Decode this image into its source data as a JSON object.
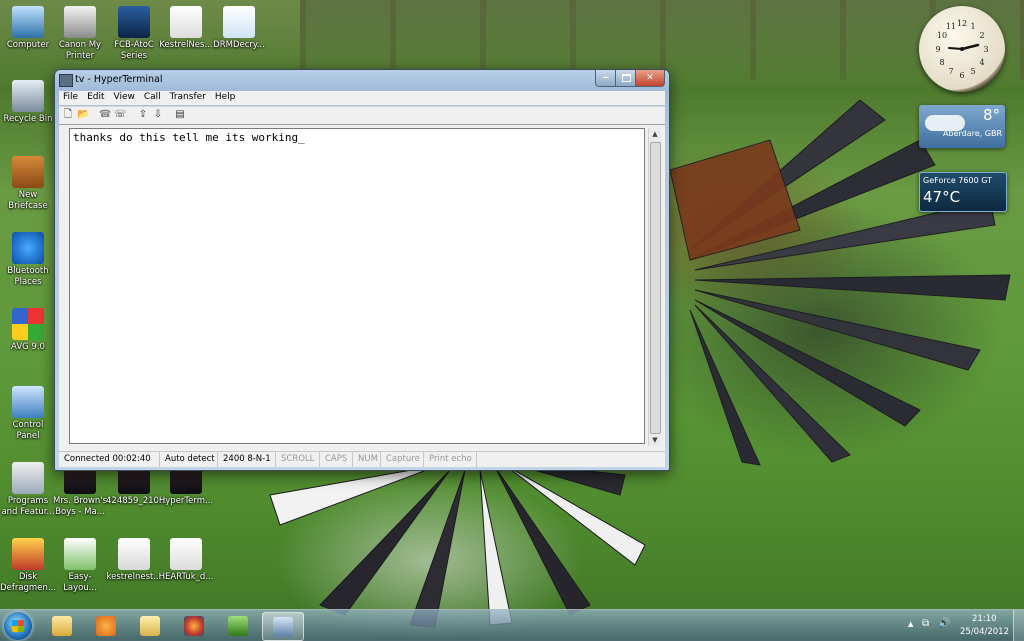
{
  "desktop_icons": [
    {
      "label": "Computer",
      "icon": "computer-icon"
    },
    {
      "label": "Canon My Printer",
      "icon": "printer-icon"
    },
    {
      "label": "FCB-AtoC Series",
      "icon": "app-shortcut-icon"
    },
    {
      "label": "KestrelNes...",
      "icon": "pdf-icon"
    },
    {
      "label": "DRMDecry...",
      "icon": "document-icon"
    },
    {
      "label": "Recycle Bin",
      "icon": "recycle-bin-icon"
    },
    {
      "label": "New Briefcase",
      "icon": "briefcase-icon"
    },
    {
      "label": "Bluetooth Places",
      "icon": "bluetooth-icon"
    },
    {
      "label": "AVG 9.0",
      "icon": "avg-icon"
    },
    {
      "label": "Control Panel",
      "icon": "control-panel-icon"
    },
    {
      "label": "Programs and Featur...",
      "icon": "programs-icon"
    },
    {
      "label": "Mrs. Brown's Boys - Ma...",
      "icon": "video-icon"
    },
    {
      "label": "424859_210...",
      "icon": "video-icon"
    },
    {
      "label": "HyperTerm...",
      "icon": "video-icon"
    },
    {
      "label": "Disk Defragmen...",
      "icon": "defrag-icon"
    },
    {
      "label": "Easy-Layou...",
      "icon": "easy-layout-icon"
    },
    {
      "label": "kestrelnest...",
      "icon": "image-icon"
    },
    {
      "label": "HEARTuk_d...",
      "icon": "pdf-icon"
    }
  ],
  "gadgets": {
    "weather": {
      "temp": "8°",
      "location": "Aberdare, GBR"
    },
    "gpu": {
      "name": "GeForce 7600 GT",
      "temp": "47°C"
    }
  },
  "window": {
    "title": "tv - HyperTerminal",
    "menu": [
      "File",
      "Edit",
      "View",
      "Call",
      "Transfer",
      "Help"
    ],
    "terminal_text": "thanks do this tell me its working_",
    "status": {
      "connected": "Connected 00:02:40",
      "detect": "Auto detect",
      "settings": "2400 8-N-1",
      "scroll": "SCROLL",
      "caps": "CAPS",
      "num": "NUM",
      "capture": "Capture",
      "print_echo": "Print echo"
    }
  },
  "taskbar": {
    "items": [
      "explorer-icon",
      "media-player-icon",
      "folder-icon",
      "firefox-icon",
      "network-icon",
      "hyperterminal-icon"
    ],
    "active_index": 5,
    "time": "21:10",
    "date": "25/04/2012"
  }
}
